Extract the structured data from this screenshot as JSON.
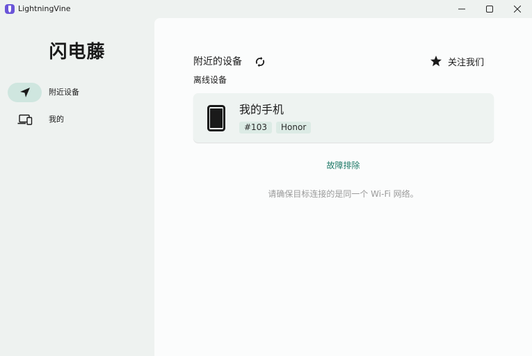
{
  "window": {
    "title": "LightningVine"
  },
  "sidebar": {
    "brand": "闪电藤",
    "items": [
      {
        "label": "附近设备",
        "icon": "navigation-arrow-icon",
        "active": true
      },
      {
        "label": "我的",
        "icon": "devices-icon",
        "active": false
      }
    ]
  },
  "main": {
    "section_title": "附近的设备",
    "follow_label": "关注我们",
    "offline_title": "离线设备",
    "device": {
      "name": "我的手机",
      "id": "#103",
      "brand": "Honor"
    },
    "troubleshoot": "故障排除",
    "hint": "请确保目标连接的是同一个 Wi-Fi 网络。"
  },
  "colors": {
    "accent": "#1f7a68",
    "active_pill": "#cfe6df",
    "sidebar_bg": "#eef2f0",
    "content_bg": "#fbfcfc",
    "card_bg": "#eef3f1",
    "chip_bg": "#dcebe5",
    "app_icon": "#6a55d8"
  }
}
